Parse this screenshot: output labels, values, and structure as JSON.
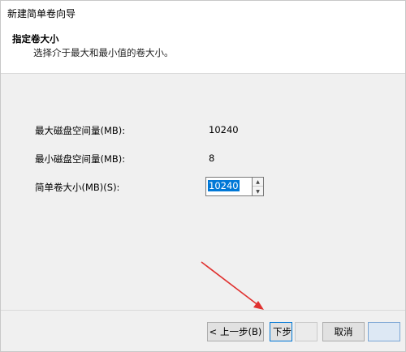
{
  "window": {
    "title": "新建简单卷向导"
  },
  "header": {
    "title": "指定卷大小",
    "subtitle": "选择介于最大和最小值的卷大小。"
  },
  "fields": {
    "max_label": "最大磁盘空间量(MB):",
    "max_value": "10240",
    "min_label": "最小磁盘空间量(MB):",
    "min_value": "8",
    "size_label": "简单卷大小(MB)(S):",
    "size_value": "10240"
  },
  "buttons": {
    "back": "< 上一步(B)",
    "next": "下步",
    "cancel": "取消"
  },
  "colors": {
    "arrow": "#e0312f",
    "selection": "#0078d7"
  }
}
